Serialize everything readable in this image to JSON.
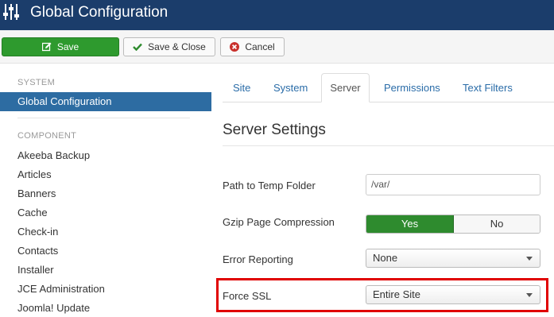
{
  "header": {
    "title": "Global Configuration",
    "app_icon": "sliders-icon"
  },
  "toolbar": {
    "save_label": "Save",
    "save_close_label": "Save & Close",
    "cancel_label": "Cancel",
    "save_icon": "edit-icon",
    "save_close_icon": "check-icon",
    "cancel_icon": "close-circle-icon"
  },
  "sidebar": {
    "system_heading": "SYSTEM",
    "active_item": "Global Configuration",
    "component_heading": "COMPONENT",
    "items": [
      "Akeeba Backup",
      "Articles",
      "Banners",
      "Cache",
      "Check-in",
      "Contacts",
      "Installer",
      "JCE Administration",
      "Joomla! Update"
    ]
  },
  "tabs": [
    "Site",
    "System",
    "Server",
    "Permissions",
    "Text Filters"
  ],
  "active_tab": "Server",
  "main": {
    "heading": "Server Settings",
    "fields": {
      "temp_path": {
        "label": "Path to Temp Folder",
        "value": "/var/"
      },
      "gzip": {
        "label": "Gzip Page Compression",
        "yes": "Yes",
        "no": "No",
        "selected": "Yes"
      },
      "error_reporting": {
        "label": "Error Reporting",
        "value": "None"
      },
      "force_ssl": {
        "label": "Force SSL",
        "value": "Entire Site"
      }
    }
  },
  "colors": {
    "header_bg": "#1b3d6b",
    "save_green": "#2e9a2e",
    "active_blue": "#2d6ca2",
    "link_blue": "#2a6ca8",
    "highlight_red": "#e00000"
  }
}
